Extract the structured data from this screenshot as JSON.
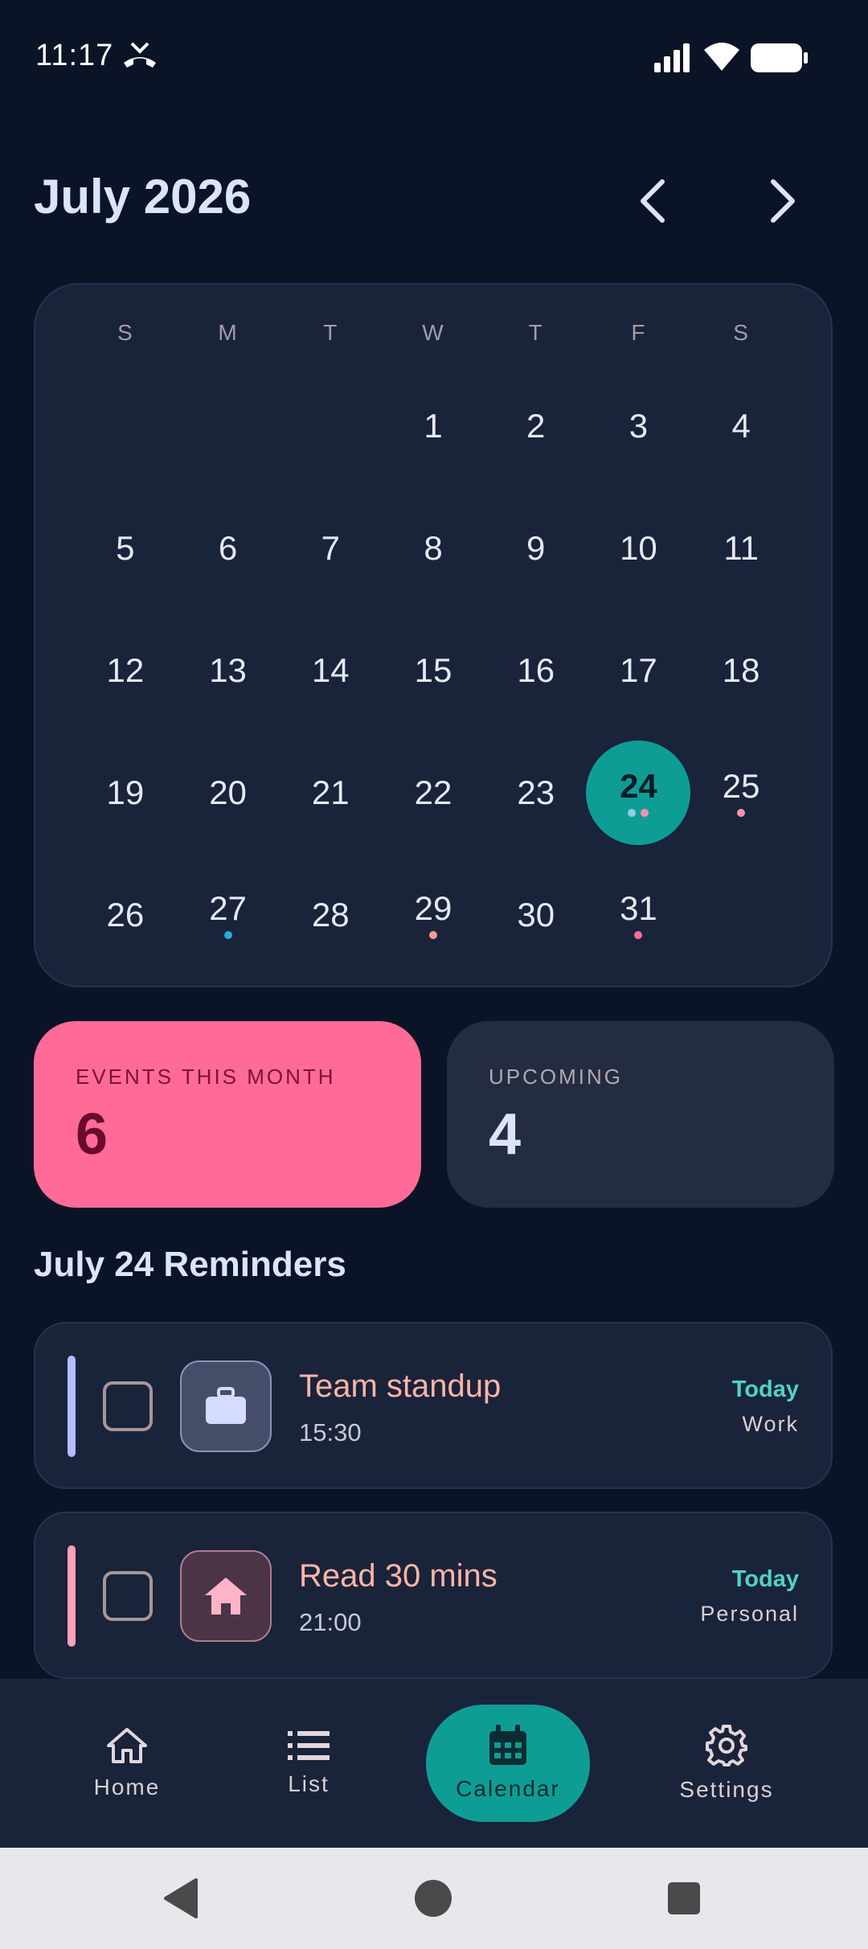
{
  "status_bar": {
    "time": "11:17",
    "icons": [
      "call-missed-icon",
      "signal-icon",
      "wifi-icon",
      "battery-icon"
    ]
  },
  "header": {
    "month_title": "July 2026",
    "prev_icon": "chevron-left-icon",
    "next_icon": "chevron-right-icon"
  },
  "calendar": {
    "weekdays": [
      "S",
      "M",
      "T",
      "W",
      "T",
      "F",
      "S"
    ],
    "leading_blanks": 3,
    "days": [
      "1",
      "2",
      "3",
      "4",
      "5",
      "6",
      "7",
      "8",
      "9",
      "10",
      "11",
      "12",
      "13",
      "14",
      "15",
      "16",
      "17",
      "18",
      "19",
      "20",
      "21",
      "22",
      "23",
      "24",
      "25",
      "26",
      "27",
      "28",
      "29",
      "30",
      "31"
    ],
    "selected_day": "24",
    "event_dots": {
      "24": [
        "#8fcfe8",
        "#ff8fb0"
      ],
      "25": [
        "#ff8fb0"
      ],
      "27": [
        "#29a9e0"
      ],
      "29": [
        "#ff9b8a"
      ],
      "31": [
        "#ff6b96"
      ]
    }
  },
  "stats": {
    "events_label": "EVENTS THIS MONTH",
    "events_value": "6",
    "upcoming_label": "UPCOMING",
    "upcoming_value": "4"
  },
  "reminders": {
    "section_title": "July 24 Reminders",
    "items": [
      {
        "title": "Team standup",
        "time": "15:30",
        "when": "Today",
        "category": "Work",
        "icon": "briefcase-icon",
        "accent": "#b4bcff"
      },
      {
        "title": "Read 30 mins",
        "time": "21:00",
        "when": "Today",
        "category": "Personal",
        "icon": "home-icon",
        "accent": "#ff9fb8"
      }
    ]
  },
  "bottom_nav": {
    "items": [
      {
        "label": "Home",
        "icon": "home-outline-icon"
      },
      {
        "label": "List",
        "icon": "list-icon"
      },
      {
        "label": "Calendar",
        "icon": "calendar-icon",
        "active": true
      },
      {
        "label": "Settings",
        "icon": "gear-icon"
      }
    ]
  },
  "system_nav": {
    "icons": [
      "back-triangle-icon",
      "home-circle-icon",
      "recents-square-icon"
    ]
  },
  "colors": {
    "background": "#0b1426",
    "card": "#19233a",
    "accent_teal": "#0e9d94",
    "accent_pink": "#ff6b96"
  }
}
